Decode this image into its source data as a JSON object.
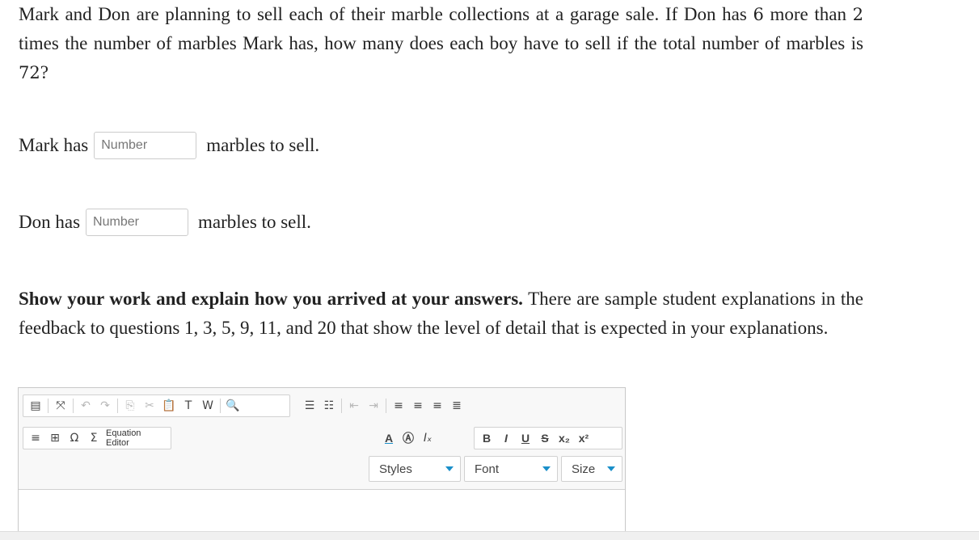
{
  "question": {
    "part1": "Mark and Don are planning to sell each of their marble collections at a garage sale. If Don has ",
    "num1": "6",
    "part2": " more than ",
    "num2": "2",
    "part3": " times the number of marbles Mark has, how many does each boy have to sell if the total number of marbles is ",
    "num3": "72",
    "part4": "?"
  },
  "mark": {
    "prefix": "Mark has",
    "placeholder": "Number",
    "suffix": "marbles to sell."
  },
  "don": {
    "prefix": "Don has",
    "placeholder": "Number",
    "suffix": "marbles to sell."
  },
  "instructions": {
    "bold": "Show your work and explain how you arrived at your answers.",
    "rest": " There are sample student explanations in the feedback to questions 1, 3, 5, 9, 11, and 20 that show the level of detail that is expected in your explanations."
  },
  "editor": {
    "equation_label_1": "Equation",
    "equation_label_2": "Editor",
    "styles_label": "Styles",
    "font_label": "Font",
    "size_label": "Size",
    "toolbar_icons": [
      "source-icon",
      "maximize-icon",
      "undo-icon",
      "redo-icon",
      "copy-icon",
      "cut-icon",
      "paste-icon",
      "paste-text-icon",
      "paste-word-icon",
      "find-icon",
      "numbered-list-icon",
      "bulleted-list-icon",
      "outdent-icon",
      "indent-icon",
      "align-left-icon",
      "align-center-icon",
      "align-right-icon",
      "justify-icon",
      "horizontal-rule-icon",
      "table-icon",
      "special-char-icon",
      "equation-icon",
      "text-color-icon",
      "bg-color-icon",
      "remove-format-icon",
      "bold-icon",
      "italic-icon",
      "underline-icon",
      "strike-icon",
      "subscript-icon",
      "superscript-icon"
    ],
    "accent": "#1a8fc9"
  }
}
